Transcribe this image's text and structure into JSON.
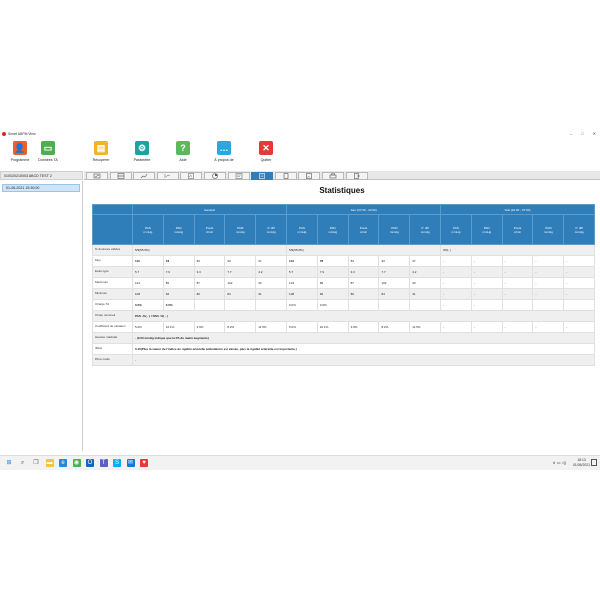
{
  "window": {
    "title": "Smart ABPM View",
    "controls": [
      "–",
      "□",
      "✕"
    ]
  },
  "ribbon": [
    {
      "label": "Programme",
      "icon": "user-add-icon",
      "color": "#e8612a",
      "glyph": "👤"
    },
    {
      "label": "Données TA",
      "icon": "data-folder-icon",
      "color": "#4caf50",
      "glyph": "▭"
    },
    {
      "label": "Récupérer",
      "icon": "download-icon",
      "color": "#f2b324",
      "glyph": "▤"
    },
    {
      "label": "Paramètre",
      "icon": "gear-icon",
      "color": "#1aa3a3",
      "glyph": "⚙"
    },
    {
      "label": "Aide",
      "icon": "help-icon",
      "color": "#5cb85c",
      "glyph": "?"
    },
    {
      "label": "À propos de",
      "icon": "chat-icon",
      "color": "#2aa6e0",
      "glyph": "…"
    },
    {
      "label": "Quitter",
      "icon": "close-icon",
      "color": "#e53935",
      "glyph": "✕"
    }
  ],
  "patient": {
    "header": "010020210003 ABCD TEST 2",
    "sessions": [
      "01-06-2021 15:30:00"
    ]
  },
  "tabs": [
    {
      "icon": "edit-icon"
    },
    {
      "icon": "table-icon"
    },
    {
      "icon": "line-chart-icon"
    },
    {
      "icon": "trend-chart-icon"
    },
    {
      "icon": "report-chart-icon"
    },
    {
      "icon": "pie-chart-icon"
    },
    {
      "icon": "list-chart-icon"
    },
    {
      "icon": "statistics-icon",
      "active": true
    },
    {
      "icon": "document-icon"
    },
    {
      "icon": "image-icon"
    },
    {
      "icon": "print-icon"
    },
    {
      "icon": "export-icon"
    }
  ],
  "statistics": {
    "title": "Statistiques",
    "groups": [
      "Général",
      "Jour (07:00 - 22:00)",
      "Nuit (22:00 - 07:00)"
    ],
    "columns": [
      "PAS\nmmHg",
      "PAD\nmmHg",
      "Pouls\nc/min",
      "PAM\nmmHg",
      "P. diff\nmmHg",
      "PAS\nmmHg",
      "PAD\nmmHg",
      "Pouls\nc/min",
      "PAM\nmmHg",
      "P. diff\nmmHg",
      "PAS\nmmHg",
      "PAD\nmmHg",
      "Pouls\nc/min",
      "PAM\nmmHg",
      "P. diff\nmmHg"
    ],
    "valid": {
      "label": "% données valides",
      "general": "5/9(55.6%)",
      "day": "5/9(55.6%)",
      "night": "0/0(- )"
    },
    "rows": [
      {
        "label": "Moy.",
        "bold": [
          0,
          1,
          5,
          6
        ],
        "values": [
          "110",
          "78",
          "83",
          "93",
          "37",
          "110",
          "78",
          "83",
          "93",
          "37",
          "-",
          "-",
          "-",
          "-",
          "-"
        ]
      },
      {
        "label": "Ecart-type",
        "values": [
          "5.7",
          "7.9",
          "3.3",
          "7.7",
          "4.2",
          "5.7",
          "7.9",
          "3.3",
          "7.7",
          "4.2",
          "-",
          "-",
          "-",
          "-",
          "-"
        ]
      },
      {
        "label": "Maximum",
        "values": [
          "123",
          "86",
          "87",
          "102",
          "43",
          "123",
          "86",
          "87",
          "102",
          "43",
          "-",
          "-",
          "-",
          "-",
          "-"
        ]
      },
      {
        "label": "Minimum",
        "values": [
          "108",
          "66",
          "80",
          "84",
          "31",
          "108",
          "66",
          "80",
          "84",
          "31",
          "-",
          "-",
          "-",
          "-",
          "-"
        ]
      }
    ],
    "charge": {
      "label": "Charge TA",
      "values": [
        "0.0%",
        "0.0%",
        "",
        "",
        "",
        "0.0%",
        "0.0%",
        "",
        "",
        "",
        "-",
        "-",
        "",
        "",
        ""
      ]
    },
    "cv": {
      "label": "Coefficient de variation",
      "values": [
        "5.0%",
        "10.1%",
        "3.9%",
        "8.2%",
        "11.5%",
        "5.0%",
        "10.1%",
        "3.9%",
        "8.2%",
        "11.5%",
        "-",
        "-",
        "-",
        "-",
        "-"
      ]
    },
    "chute": {
      "label": "Chute nommeil",
      "text": "PAS  -%( - )  /  PAD  -%( - )"
    },
    "hausse": {
      "label": "Hausse matinale",
      "text": "- (0.00 mmHg indique que la PA du matin augmente)"
    },
    "iraa": {
      "label": "IRAA",
      "text": "0.10(Plus la valeur de l'indice de rigidité artérielle ambulatoire est élevée, plus la rigidité artérielle est importante.)"
    },
    "pamatin": {
      "label": "PA le matin",
      "text": "-"
    }
  },
  "taskbar": {
    "icons": [
      {
        "icon": "windows-start-icon",
        "color": "#1e88e5"
      },
      {
        "icon": "search-icon",
        "color": "#555555"
      },
      {
        "icon": "task-view-icon",
        "color": "#555555"
      },
      {
        "icon": "file-explorer-icon",
        "color": "#f6c342"
      },
      {
        "icon": "edge-icon",
        "color": "#1e88e5"
      },
      {
        "icon": "chrome-icon",
        "color": "#4caf50"
      },
      {
        "icon": "outlook-icon",
        "color": "#1565c0"
      },
      {
        "icon": "teams-icon",
        "color": "#5c5fc4"
      },
      {
        "icon": "skype-icon",
        "color": "#00aff0"
      },
      {
        "icon": "mail-icon",
        "color": "#1976d2"
      },
      {
        "icon": "abpm-app-icon",
        "color": "#e53935"
      }
    ],
    "time": "18:13",
    "date": "01/06/2021",
    "tray": "∧ ▭ ◁)"
  }
}
